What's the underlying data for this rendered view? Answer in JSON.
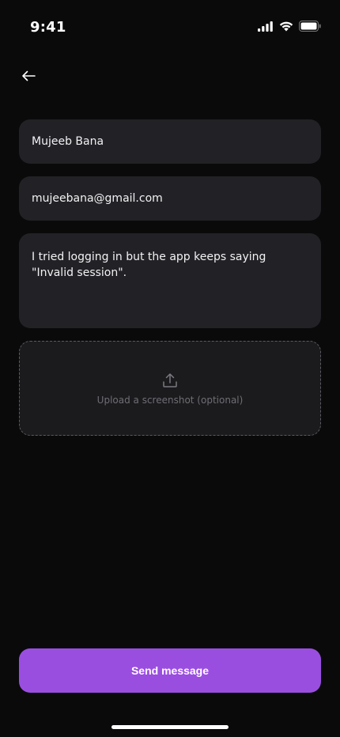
{
  "status_bar": {
    "time": "9:41",
    "icons": [
      "signal-icon",
      "wifi-icon",
      "battery-icon"
    ]
  },
  "navigation": {
    "back_icon": "arrow-left-icon"
  },
  "form": {
    "name_value": "Mujeeb Bana",
    "email_value": "mujeebana@gmail.com",
    "message_value": "I tried logging in but the app keeps saying \"Invalid session\".",
    "upload_label": "Upload a screenshot (optional)",
    "upload_icon": "upload-icon"
  },
  "actions": {
    "send_label": "Send message"
  },
  "colors": {
    "background": "#0a0a0b",
    "field": "#222226",
    "accent": "#9a4ee0",
    "muted_text": "#6e6e74"
  }
}
